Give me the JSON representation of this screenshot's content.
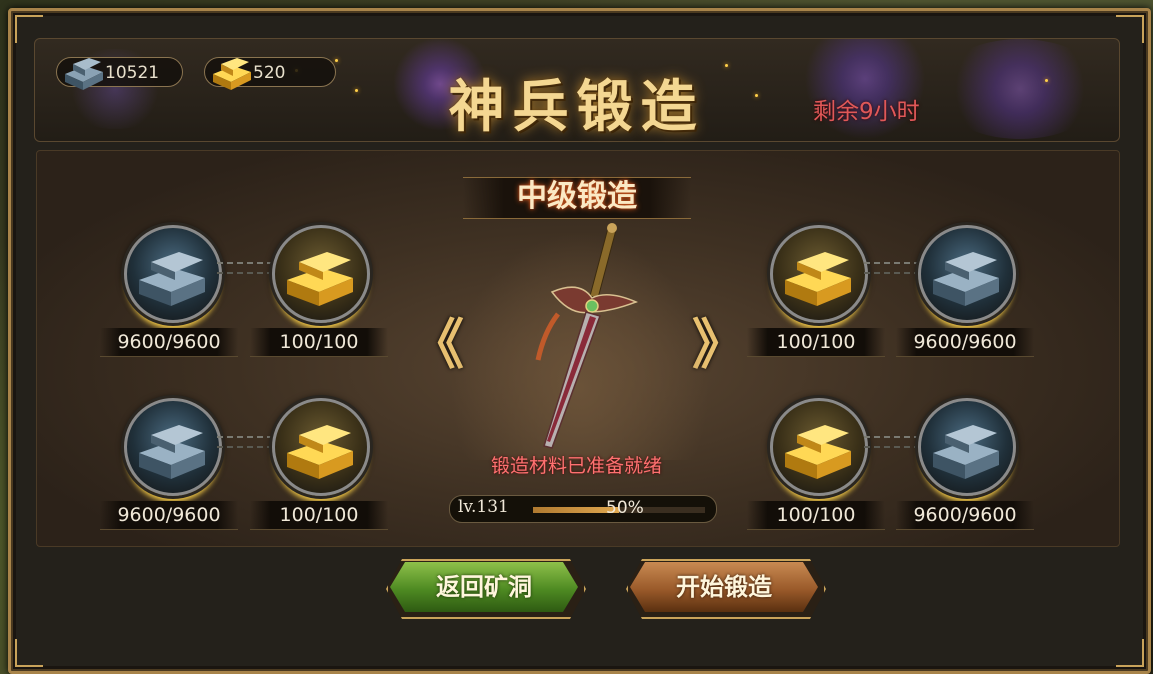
{
  "header": {
    "title": "神兵锻造",
    "timer": "剩余9小时",
    "resources": {
      "iron": {
        "icon": "iron-ingot-icon",
        "value": "10521"
      },
      "gold": {
        "icon": "gold-ingot-icon",
        "value": "520"
      }
    }
  },
  "forge": {
    "subtitle": "中级锻造",
    "prev_arrow": "《",
    "next_arrow": "》",
    "weapon_icon": "sword-icon",
    "status": "锻造材料已准备就绪",
    "level_label": "lv.131",
    "progress_text": "50%",
    "progress_value": 0.5
  },
  "materials": {
    "left_top": [
      {
        "type": "iron",
        "icon": "iron-ingot-icon",
        "count": "9600/9600"
      },
      {
        "type": "gold",
        "icon": "gold-ingot-icon",
        "count": "100/100"
      }
    ],
    "left_bottom": [
      {
        "type": "iron",
        "icon": "iron-ingot-icon",
        "count": "9600/9600"
      },
      {
        "type": "gold",
        "icon": "gold-ingot-icon",
        "count": "100/100"
      }
    ],
    "right_top": [
      {
        "type": "gold",
        "icon": "gold-ingot-icon",
        "count": "100/100"
      },
      {
        "type": "iron",
        "icon": "iron-ingot-icon",
        "count": "9600/9600"
      }
    ],
    "right_bottom": [
      {
        "type": "gold",
        "icon": "gold-ingot-icon",
        "count": "100/100"
      },
      {
        "type": "iron",
        "icon": "iron-ingot-icon",
        "count": "9600/9600"
      }
    ]
  },
  "buttons": {
    "back": "返回矿洞",
    "start": "开始锻造"
  },
  "colors": {
    "title": "#f4d792",
    "timer": "#e05858",
    "status": "#ff7070",
    "back_button": "#4e8a22",
    "start_button": "#9a5a2a"
  }
}
